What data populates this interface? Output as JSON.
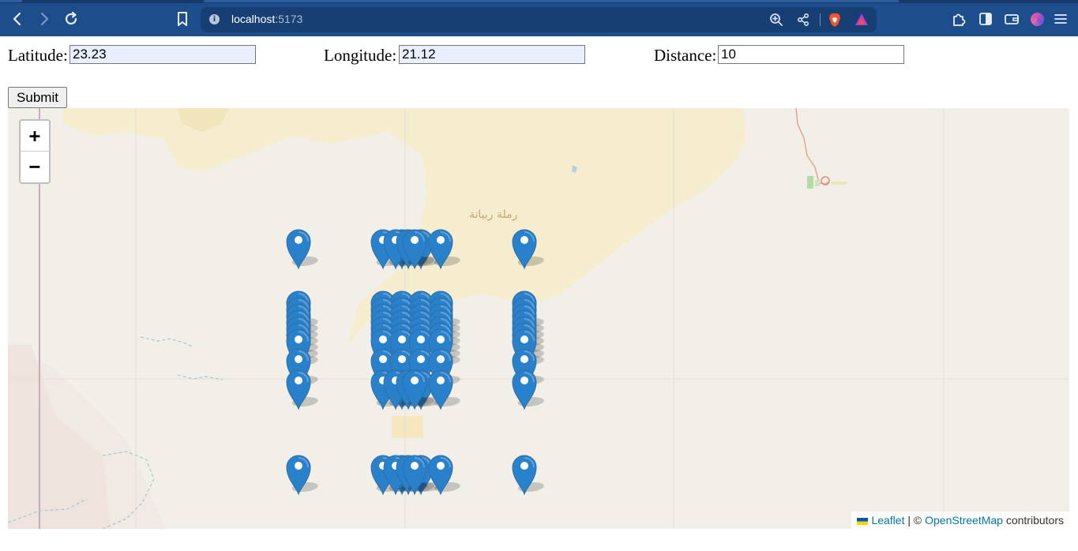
{
  "browser": {
    "url_host": "localhost",
    "url_port": ":5173",
    "nav": {
      "back_icon": "chevron-left-icon",
      "forward_icon": "chevron-right-icon",
      "reload_icon": "reload-icon",
      "bookmark_icon": "bookmark-icon"
    },
    "url_icons": [
      "site-info-icon",
      "zoom-icon",
      "share-icon",
      "brave-shields-icon",
      "rewards-icon"
    ],
    "toolbar_icons": [
      "extensions-icon",
      "sidebar-icon",
      "wallet-icon",
      "profile-avatar",
      "menu-icon"
    ]
  },
  "form": {
    "latitude_label": "Latitude:",
    "latitude_value": "23.23",
    "longitude_label": "Longitude:",
    "longitude_value": "21.12",
    "distance_label": "Distance:",
    "distance_value": "10",
    "submit_label": "Submit"
  },
  "map": {
    "zoom_in": "+",
    "zoom_out": "−",
    "place_label": "رملة ربيانة",
    "attribution": {
      "leaflet": "Leaflet",
      "separator": " | © ",
      "osm": "OpenStreetMap",
      "suffix": " contributors"
    },
    "marker_icon": "map-pin-icon",
    "marker_color": "#2a81cb",
    "marker_count": 72
  }
}
